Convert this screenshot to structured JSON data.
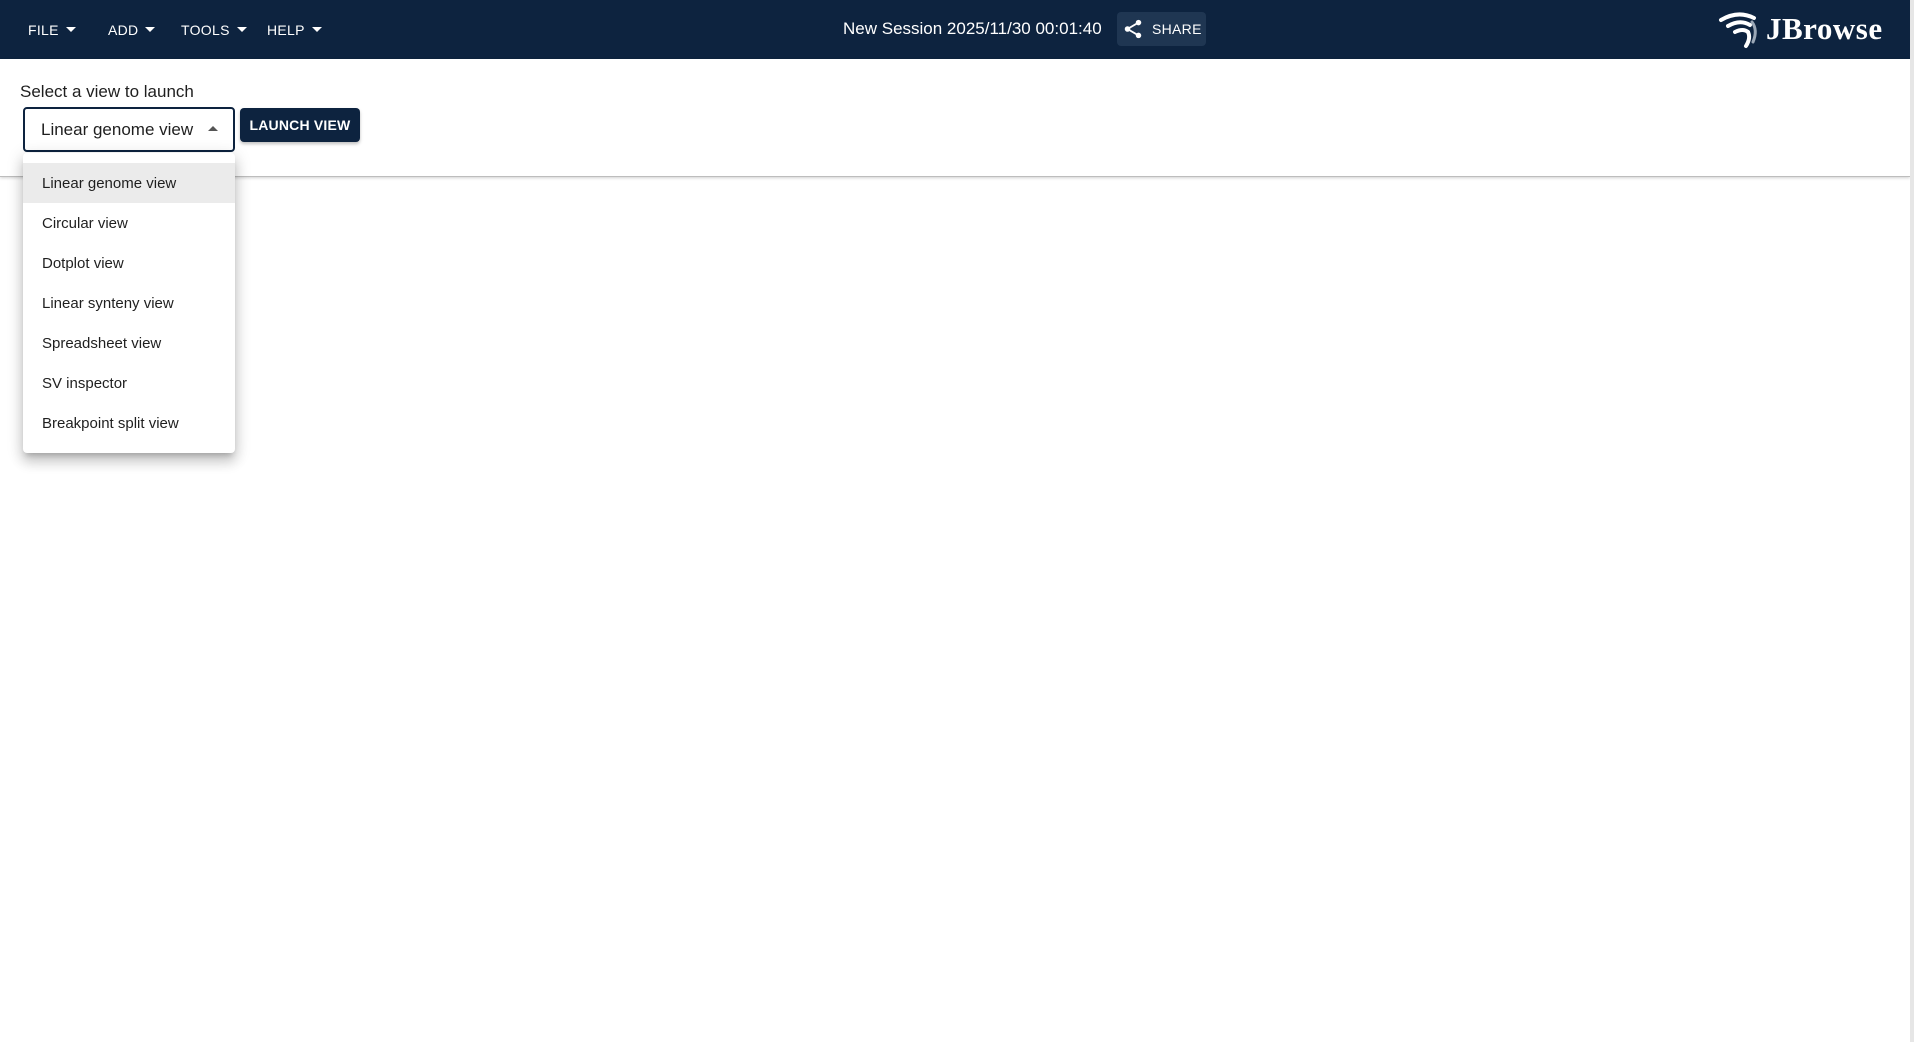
{
  "menubar": {
    "items": [
      {
        "label": "FILE"
      },
      {
        "label": "ADD"
      },
      {
        "label": "TOOLS"
      },
      {
        "label": "HELP"
      }
    ]
  },
  "session": {
    "title": "New Session 2025/11/30 00:01:40"
  },
  "share": {
    "label": "SHARE",
    "icon": "share-icon"
  },
  "logo": {
    "text": "JBrowse",
    "icon": "jbrowse-logo-icon"
  },
  "launcher": {
    "prompt": "Select a view to launch",
    "selected_view": "Linear genome view",
    "launch_label": "LAUNCH VIEW"
  },
  "dropdown": {
    "options": [
      {
        "label": "Linear genome view"
      },
      {
        "label": "Circular view"
      },
      {
        "label": "Dotplot view"
      },
      {
        "label": "Linear synteny view"
      },
      {
        "label": "Spreadsheet view"
      },
      {
        "label": "SV inspector"
      },
      {
        "label": "Breakpoint split view"
      }
    ]
  },
  "colors": {
    "appbar": "#0d233f",
    "share_bg": "#1f3652",
    "selected_option_bg": "#ebebeb"
  }
}
